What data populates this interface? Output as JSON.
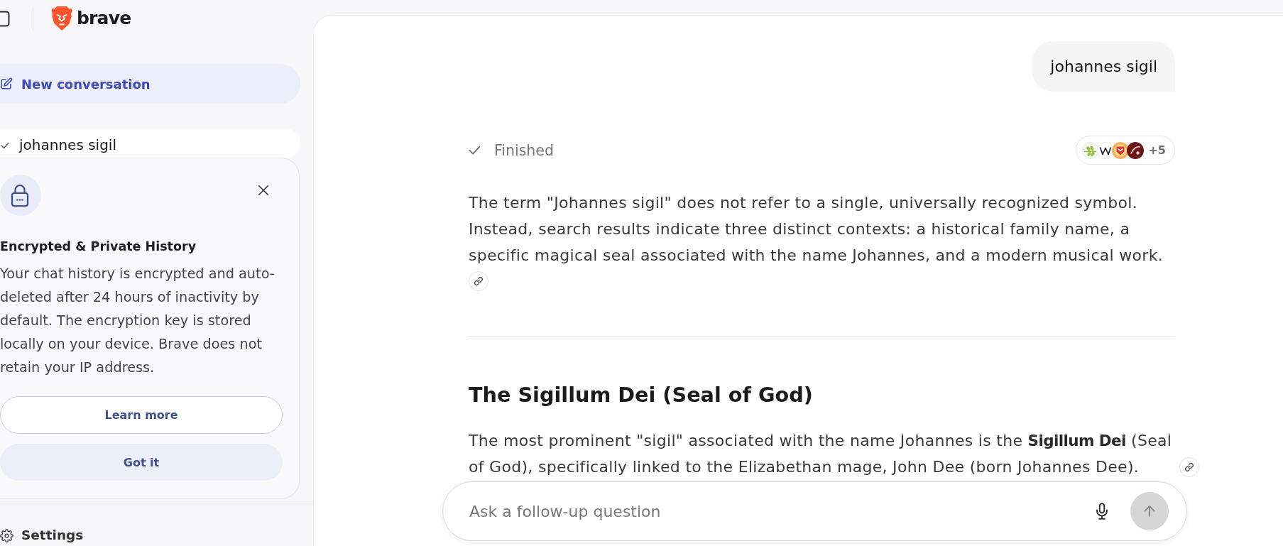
{
  "sidebar": {
    "brand": "brave",
    "new_conversation": "New conversation",
    "conversations": [
      {
        "title": "johannes sigil",
        "selected": true
      }
    ],
    "notice": {
      "title": "Encrypted & Private History",
      "body": "Your chat history is encrypted and auto-deleted after 24 hours of inactivity by default. The encryption key is stored locally on your device. Brave does not retain your IP address.",
      "buttons": [
        {
          "label": "Learn more",
          "kind": "outline"
        },
        {
          "label": "Got it",
          "kind": "filled"
        }
      ]
    },
    "settings": "Settings"
  },
  "conversation": {
    "user_message": "johannes sigil",
    "status": "Finished",
    "sources": {
      "more": "+5"
    },
    "blocks": [
      {
        "kind": "paragraph",
        "text": "The term \"Johannes sigil\" does not refer to a single, universally recognized symbol. Instead, search results indicate three distinct contexts: a historical family name, a specific magical seal associated with the name Johannes, and a modern musical work.",
        "citation": true
      },
      {
        "kind": "divider"
      },
      {
        "kind": "heading",
        "text": "The Sigillum Dei (Seal of God)"
      },
      {
        "kind": "paragraph",
        "text": "The most prominent \"sigil\" associated with the name Johannes is the **Sigillum Dei** (Seal of God), specifically linked to the Elizabethan mage, John Dee (born Johannes Dee).",
        "citation": true
      }
    ]
  },
  "composer": {
    "placeholder": "Ask a follow-up question"
  }
}
